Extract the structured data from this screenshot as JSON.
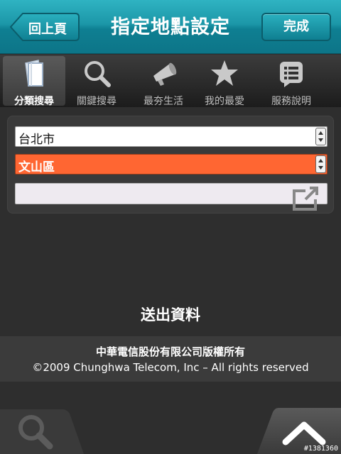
{
  "header": {
    "title": "指定地點設定",
    "back_label": "回上頁",
    "done_label": "完成"
  },
  "tabs": [
    {
      "label": "分類搜尋",
      "icon": "folder-icon",
      "active": true
    },
    {
      "label": "關鍵搜尋",
      "icon": "search-icon",
      "active": false
    },
    {
      "label": "最夯生活",
      "icon": "megaphone-icon",
      "active": false
    },
    {
      "label": "我的最愛",
      "icon": "star-icon",
      "active": false
    },
    {
      "label": "服務說明",
      "icon": "document-icon",
      "active": false
    }
  ],
  "form": {
    "city": "台北市",
    "district": "文山區",
    "road": "",
    "submit_label": "送出資料"
  },
  "footer": {
    "line1": "中華電信股份有限公司版權所有",
    "line2": "©2009 Chunghwa Telecom, Inc – All rights reserved"
  },
  "watermark": "#1381360",
  "colors": {
    "header": "#1c97a8",
    "selected_field": "#ff6632",
    "background": "#2e2e2e"
  }
}
